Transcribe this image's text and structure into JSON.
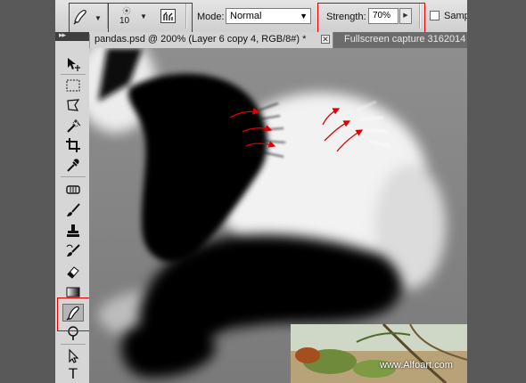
{
  "options_bar": {
    "tool_preset_icon": "smudge-finger-icon",
    "brush_size": "10",
    "mode_label": "Mode:",
    "mode_value": "Normal",
    "strength_label": "Strength:",
    "strength_value": "70%",
    "sample_label": "Sample All Layers"
  },
  "document_tabs": [
    {
      "label": "pandas.psd @ 200% (Layer 6 copy 4, RGB/8#) *",
      "active": true
    },
    {
      "label": "Fullscreen capture 3162014",
      "active": false
    }
  ],
  "toolbox": {
    "collapse_glyph": "▸▸",
    "tools": [
      {
        "name": "move-tool-icon"
      },
      {
        "name": "rectangular-marquee-tool-icon"
      },
      {
        "name": "lasso-tool-icon"
      },
      {
        "name": "magic-wand-tool-icon"
      },
      {
        "name": "crop-tool-icon"
      },
      {
        "name": "eyedropper-tool-icon"
      },
      {
        "name": "healing-brush-tool-icon"
      },
      {
        "name": "brush-tool-icon"
      },
      {
        "name": "clone-stamp-tool-icon"
      },
      {
        "name": "history-brush-tool-icon"
      },
      {
        "name": "eraser-tool-icon"
      },
      {
        "name": "gradient-tool-icon"
      },
      {
        "name": "smudge-tool-icon",
        "active": true
      },
      {
        "name": "dodge-tool-icon"
      },
      {
        "name": "path-selection-tool-icon"
      },
      {
        "name": "type-tool-icon",
        "glyph": "T"
      }
    ]
  },
  "watermark": "www.Alfoart.com",
  "colors": {
    "callout_red": "#e00000",
    "canvas_gray": "#8a8a8a",
    "panda_black": "#000000"
  }
}
